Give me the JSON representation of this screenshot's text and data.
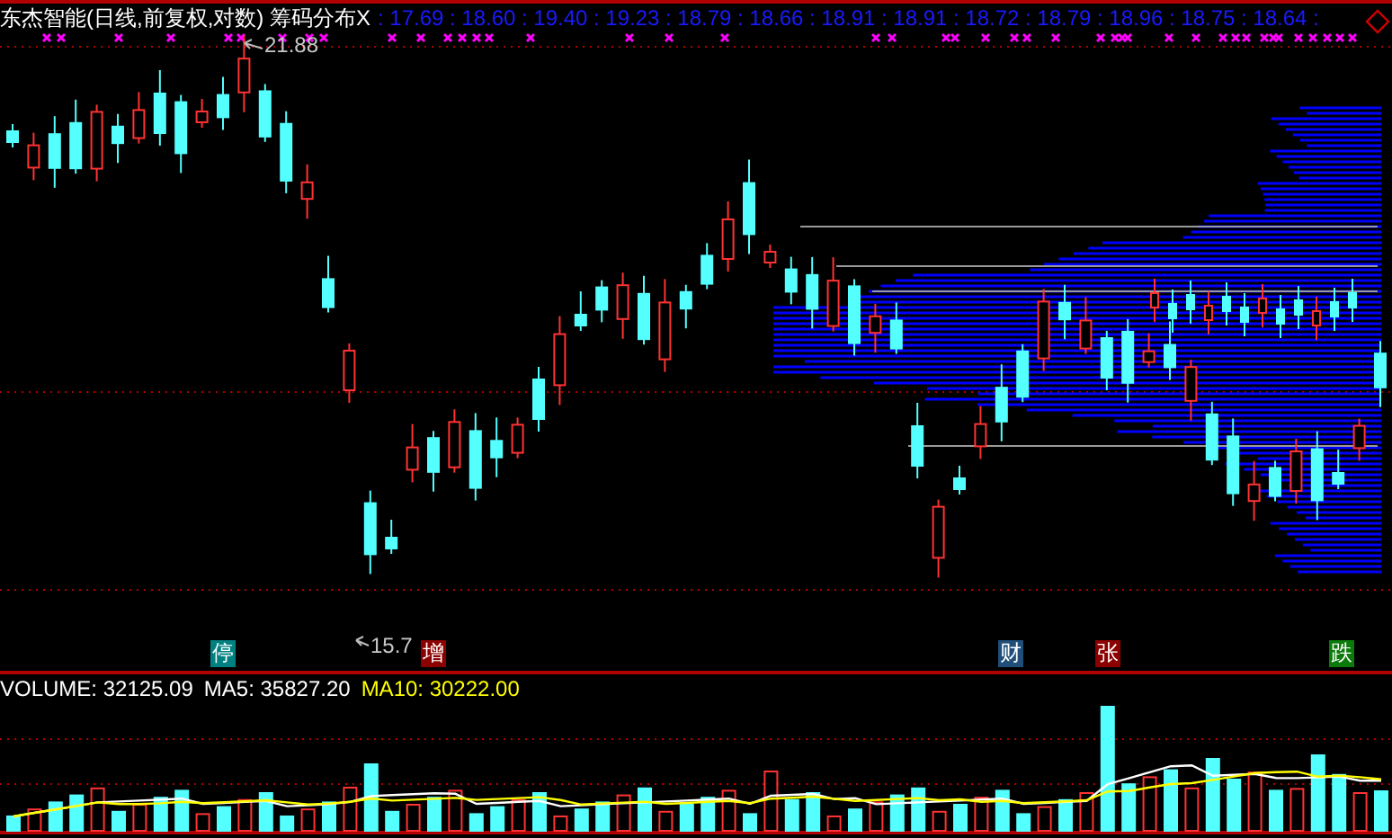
{
  "title": "东杰智能(日线,前复权,对数) 筹码分布X",
  "header_values": [
    ": 17.69",
    ": 18.60",
    ": 19.40",
    ": 19.23",
    ": 18.79",
    ": 18.66",
    ": 18.91",
    ": 18.91",
    ": 18.72",
    ": 18.79",
    ": 18.96",
    ": 18.75",
    ": 18.64"
  ],
  "header_trailing": ":",
  "price_labels": [
    {
      "kind": "high",
      "text": "21.88"
    },
    {
      "kind": "low",
      "text": "15.7"
    }
  ],
  "badges": [
    {
      "text": "停",
      "color": "#008080"
    },
    {
      "text": "增",
      "color": "#8b0000"
    },
    {
      "text": "财",
      "color": "#1f4e79"
    },
    {
      "text": "张",
      "color": "#8b0000"
    },
    {
      "text": "跌",
      "color": "#0a7a0a"
    }
  ],
  "volume": {
    "label": "VOLUME: 32125.09",
    "ma5": "MA5: 35827.20",
    "ma10": "MA10: 30222.00"
  }
}
